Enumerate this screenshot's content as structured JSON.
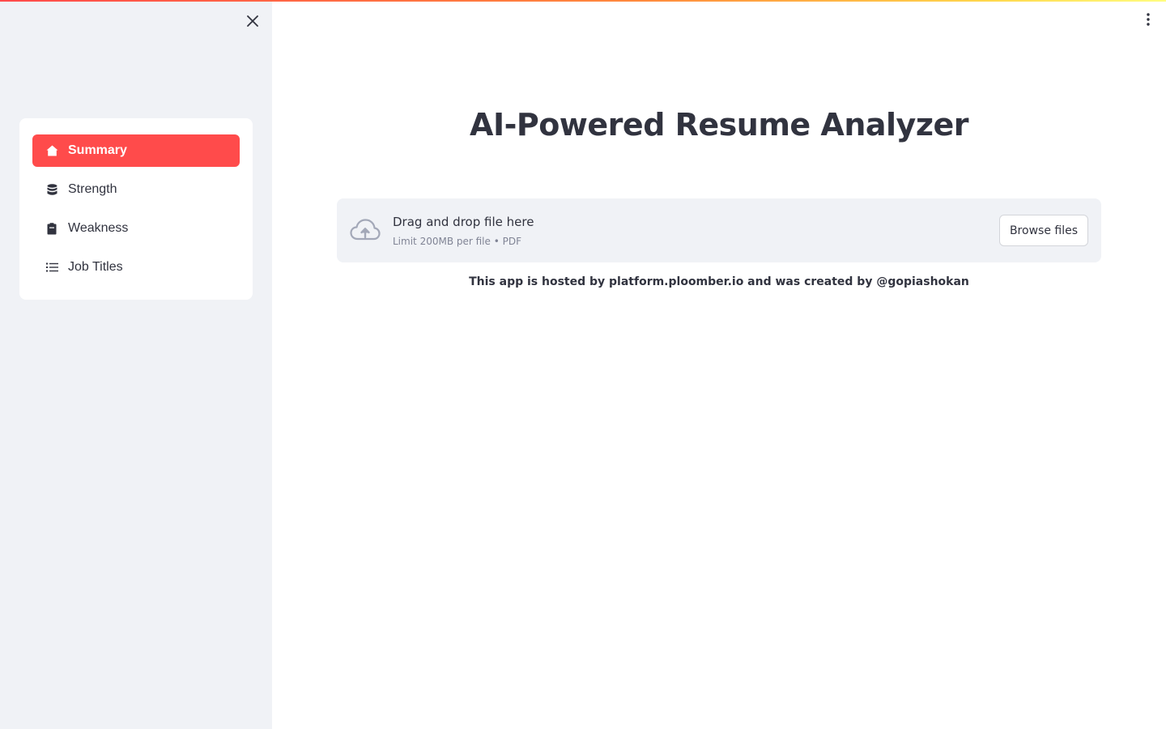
{
  "sidebar": {
    "items": [
      {
        "label": "Summary",
        "icon": "house-icon",
        "active": true
      },
      {
        "label": "Strength",
        "icon": "database-icon",
        "active": false
      },
      {
        "label": "Weakness",
        "icon": "clipboard-icon",
        "active": false
      },
      {
        "label": "Job Titles",
        "icon": "list-icon",
        "active": false
      }
    ]
  },
  "main": {
    "title": "AI-Powered Resume Analyzer",
    "uploader": {
      "drop_text": "Drag and drop file here",
      "limit_text": "Limit 200MB per file • PDF",
      "browse_label": "Browse files"
    },
    "footer": "This app is hosted by platform.ploomber.io and was created by @gopiashokan"
  },
  "colors": {
    "accent": "#ff4b4b",
    "sidebar_bg": "#f0f2f6",
    "text": "#31333f"
  }
}
